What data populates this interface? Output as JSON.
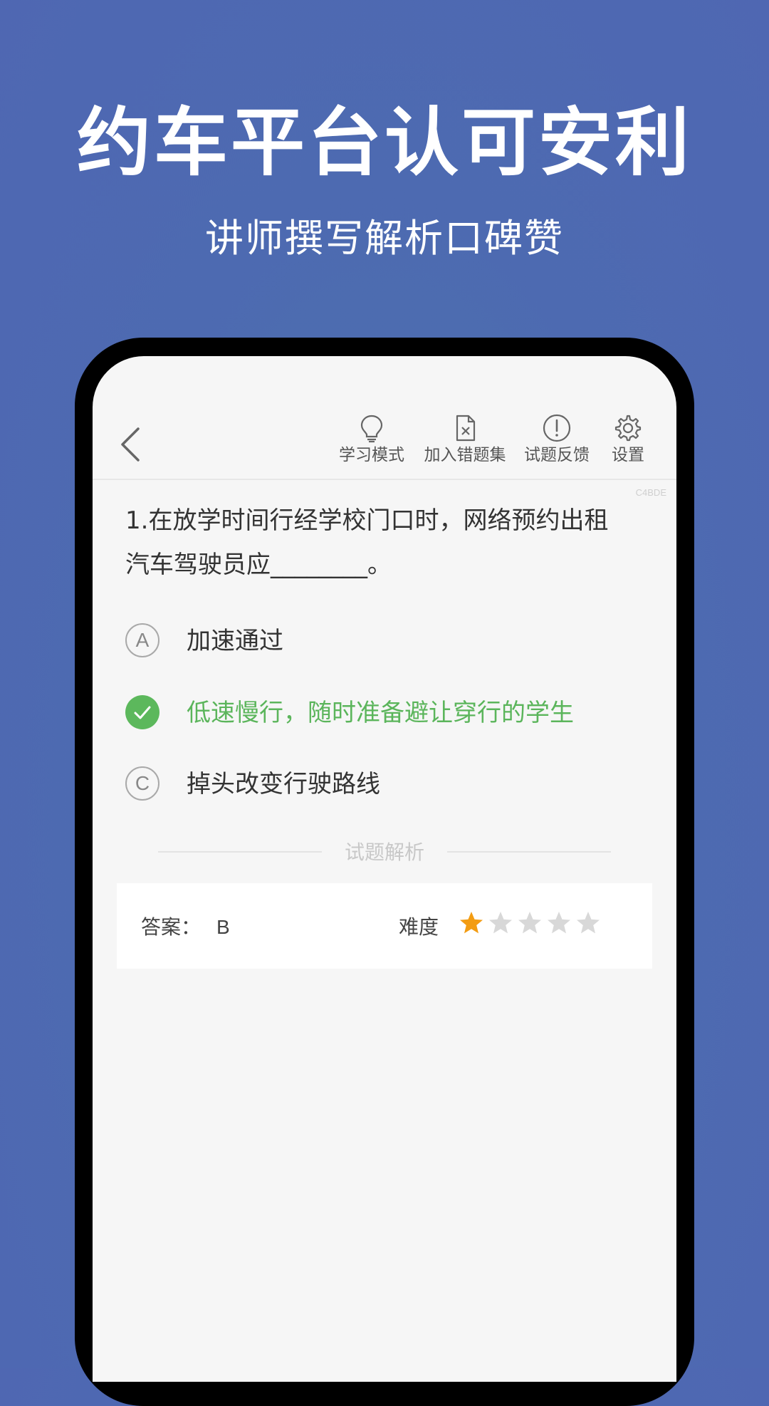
{
  "hero": {
    "title": "约车平台认可安利",
    "subtitle": "讲师撰写解析口碑赞"
  },
  "toolbar": {
    "items": [
      {
        "label": "学习模式",
        "icon": "lightbulb-icon"
      },
      {
        "label": "加入错题集",
        "icon": "document-x-icon"
      },
      {
        "label": "试题反馈",
        "icon": "exclamation-circle-icon"
      },
      {
        "label": "设置",
        "icon": "gear-icon"
      }
    ],
    "watermark": "C4BDE"
  },
  "question": {
    "line1": "1.在放学时间行经学校门口时，网络预约出租",
    "line2": "汽车驾驶员应________。"
  },
  "options": [
    {
      "letter": "A",
      "text": "加速通过",
      "state": "normal"
    },
    {
      "letter": "B",
      "text": "低速慢行，随时准备避让穿行的学生",
      "state": "correct"
    },
    {
      "letter": "C",
      "text": "掉头改变行驶路线",
      "state": "normal"
    }
  ],
  "analysis": {
    "section_label": "试题解析",
    "answer_label": "答案：",
    "answer_value": "B",
    "difficulty_label": "难度",
    "difficulty_rating": 1,
    "difficulty_max": 5
  },
  "colors": {
    "background": "#4d6ab1",
    "correct": "#5cb85c",
    "star_filled": "#f39c12",
    "star_empty": "#d8d8d8"
  }
}
